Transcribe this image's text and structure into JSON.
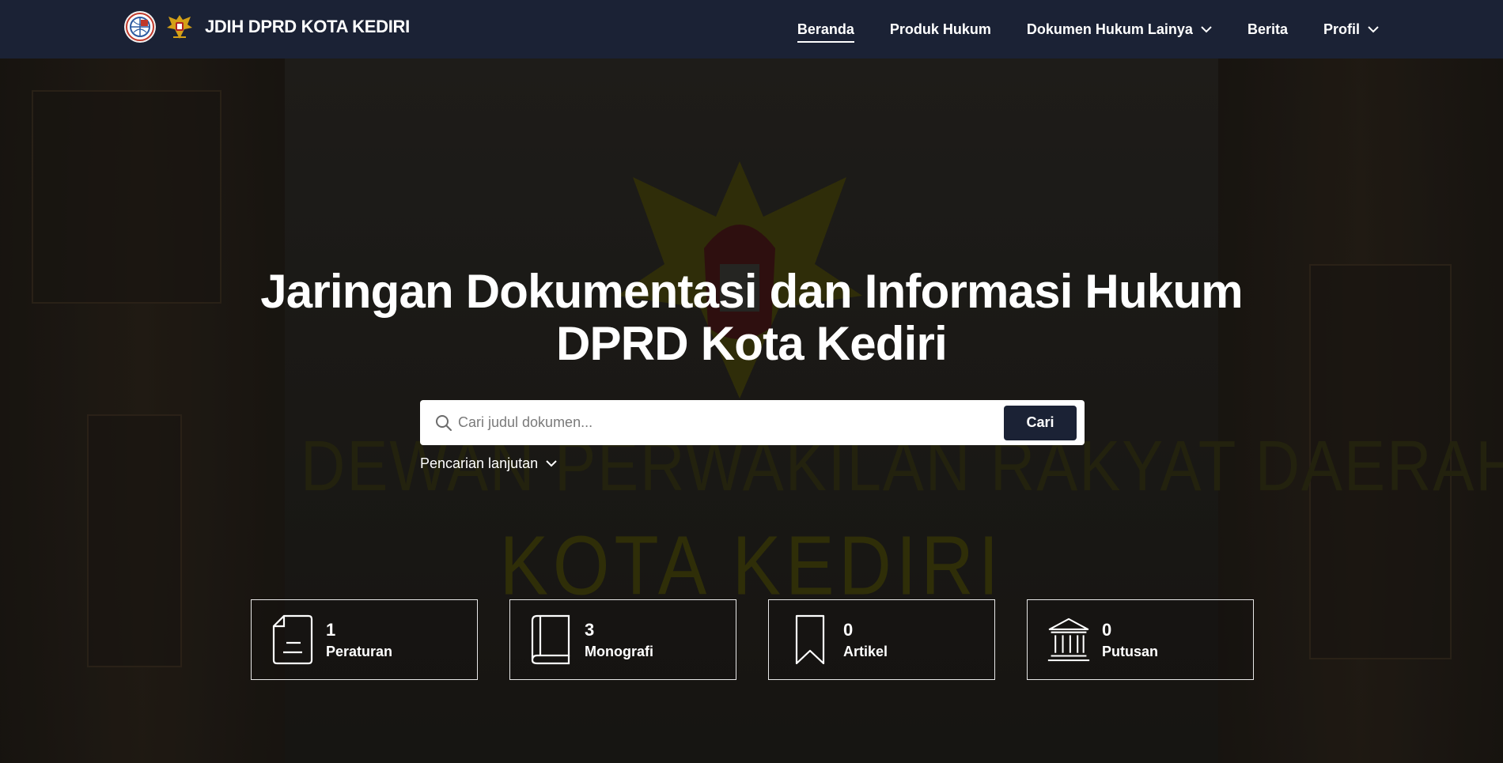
{
  "header": {
    "brand_title": "JDIH DPRD KOTA KEDIRI",
    "nav": [
      {
        "label": "Beranda",
        "active": true,
        "has_dropdown": false
      },
      {
        "label": "Produk Hukum",
        "active": false,
        "has_dropdown": false
      },
      {
        "label": "Dokumen Hukum Lainya",
        "active": false,
        "has_dropdown": true
      },
      {
        "label": "Berita",
        "active": false,
        "has_dropdown": false
      },
      {
        "label": "Profil",
        "active": false,
        "has_dropdown": true
      }
    ]
  },
  "hero": {
    "title_line1": "Jaringan Dokumentasi dan Informasi Hukum",
    "title_line2": "DPRD Kota Kediri",
    "background_text_line1": "DEWAN PERWAKILAN RAKYAT DAERAH",
    "background_text_line2": "KOTA KEDIRI"
  },
  "search": {
    "placeholder": "Cari judul dokumen...",
    "value": "",
    "button_label": "Cari",
    "advanced_label": "Pencarian lanjutan"
  },
  "stats": [
    {
      "value": "1",
      "label": "Peraturan",
      "icon": "document-icon"
    },
    {
      "value": "3",
      "label": "Monografi",
      "icon": "book-icon"
    },
    {
      "value": "0",
      "label": "Artikel",
      "icon": "bookmark-icon"
    },
    {
      "value": "0",
      "label": "Putusan",
      "icon": "courthouse-icon"
    }
  ],
  "colors": {
    "navbar_bg": "#1b2235",
    "button_bg": "#1b2235",
    "text": "#ffffff"
  }
}
